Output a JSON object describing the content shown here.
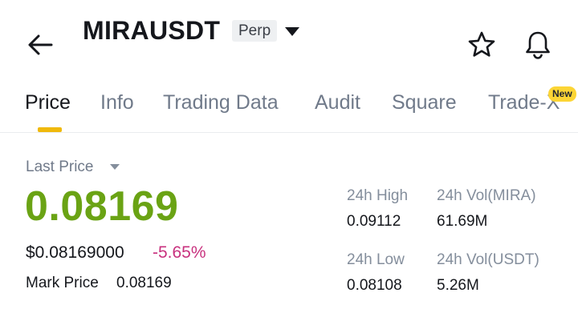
{
  "header": {
    "title": "MIRAUSDT",
    "badge": "Perp",
    "icons": [
      "back-arrow-icon",
      "caret-down-icon",
      "star-icon",
      "bell-icon"
    ]
  },
  "tabs": [
    {
      "label": "Price",
      "active": true
    },
    {
      "label": "Info",
      "active": false
    },
    {
      "label": "Trading Data",
      "active": false
    },
    {
      "label": "Audit",
      "active": false
    },
    {
      "label": "Square",
      "active": false
    },
    {
      "label": "Trade-X",
      "active": false,
      "badge": "New"
    }
  ],
  "price": {
    "label": "Last Price",
    "value": "0.08169",
    "usd_value": "$0.08169000",
    "change": "-5.65%",
    "mark_label": "Mark Price",
    "mark_value": "0.08169"
  },
  "stats": {
    "high_label": "24h High",
    "high_value": "0.09112",
    "vol_base_label": "24h Vol(MIRA)",
    "vol_base_value": "61.69M",
    "low_label": "24h Low",
    "low_value": "0.08108",
    "vol_quote_label": "24h Vol(USDT)",
    "vol_quote_value": "5.26M"
  },
  "colors": {
    "price_green": "#6aa314",
    "change_pink": "#c8317e",
    "accent_yellow": "#f0b90b",
    "badge_yellow": "#fcd535"
  }
}
